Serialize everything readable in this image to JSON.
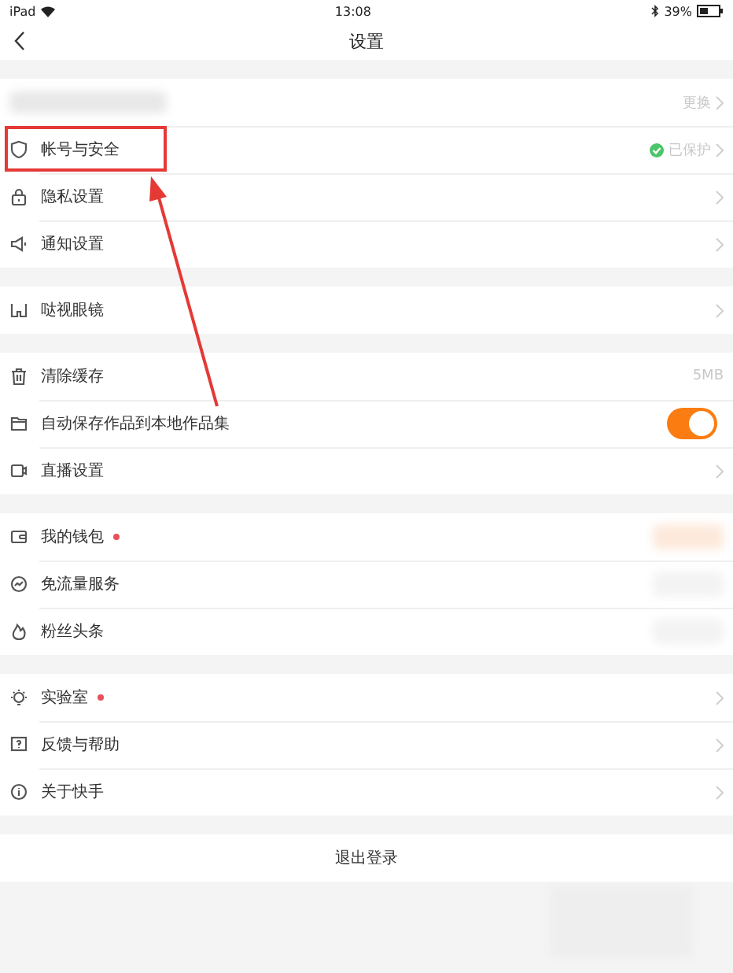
{
  "status_bar": {
    "device": "iPad",
    "time": "13:08",
    "battery": "39%"
  },
  "nav": {
    "title": "设置"
  },
  "sections": [
    {
      "rows": [
        {
          "kind": "profile",
          "value": "更换"
        },
        {
          "kind": "status",
          "label": "帐号与安全",
          "value": "已保护",
          "annotated": true
        },
        {
          "kind": "link",
          "label": "隐私设置",
          "annotated": false
        },
        {
          "kind": "link",
          "label": "通知设置",
          "annotated": false
        }
      ]
    },
    {
      "rows": [
        {
          "kind": "link",
          "label": "哒视眼镜"
        }
      ]
    },
    {
      "rows": [
        {
          "kind": "value",
          "label": "清除缓存",
          "value": "5MB"
        },
        {
          "kind": "toggle",
          "label": "自动保存作品到本地作品集",
          "on": true
        },
        {
          "kind": "link",
          "label": "直播设置"
        }
      ]
    },
    {
      "rows": [
        {
          "kind": "redacted",
          "label": "我的钱包",
          "dot": true
        },
        {
          "kind": "redacted",
          "label": "免流量服务",
          "dot": false
        },
        {
          "kind": "redacted",
          "label": "粉丝头条",
          "dot": false
        }
      ]
    },
    {
      "rows": [
        {
          "kind": "link",
          "label": "实验室",
          "dot": true
        },
        {
          "kind": "link",
          "label": "反馈与帮助",
          "dot": false
        },
        {
          "kind": "link",
          "label": "关于快手",
          "dot": false
        }
      ]
    }
  ],
  "logout": {
    "label": "退出登录"
  }
}
